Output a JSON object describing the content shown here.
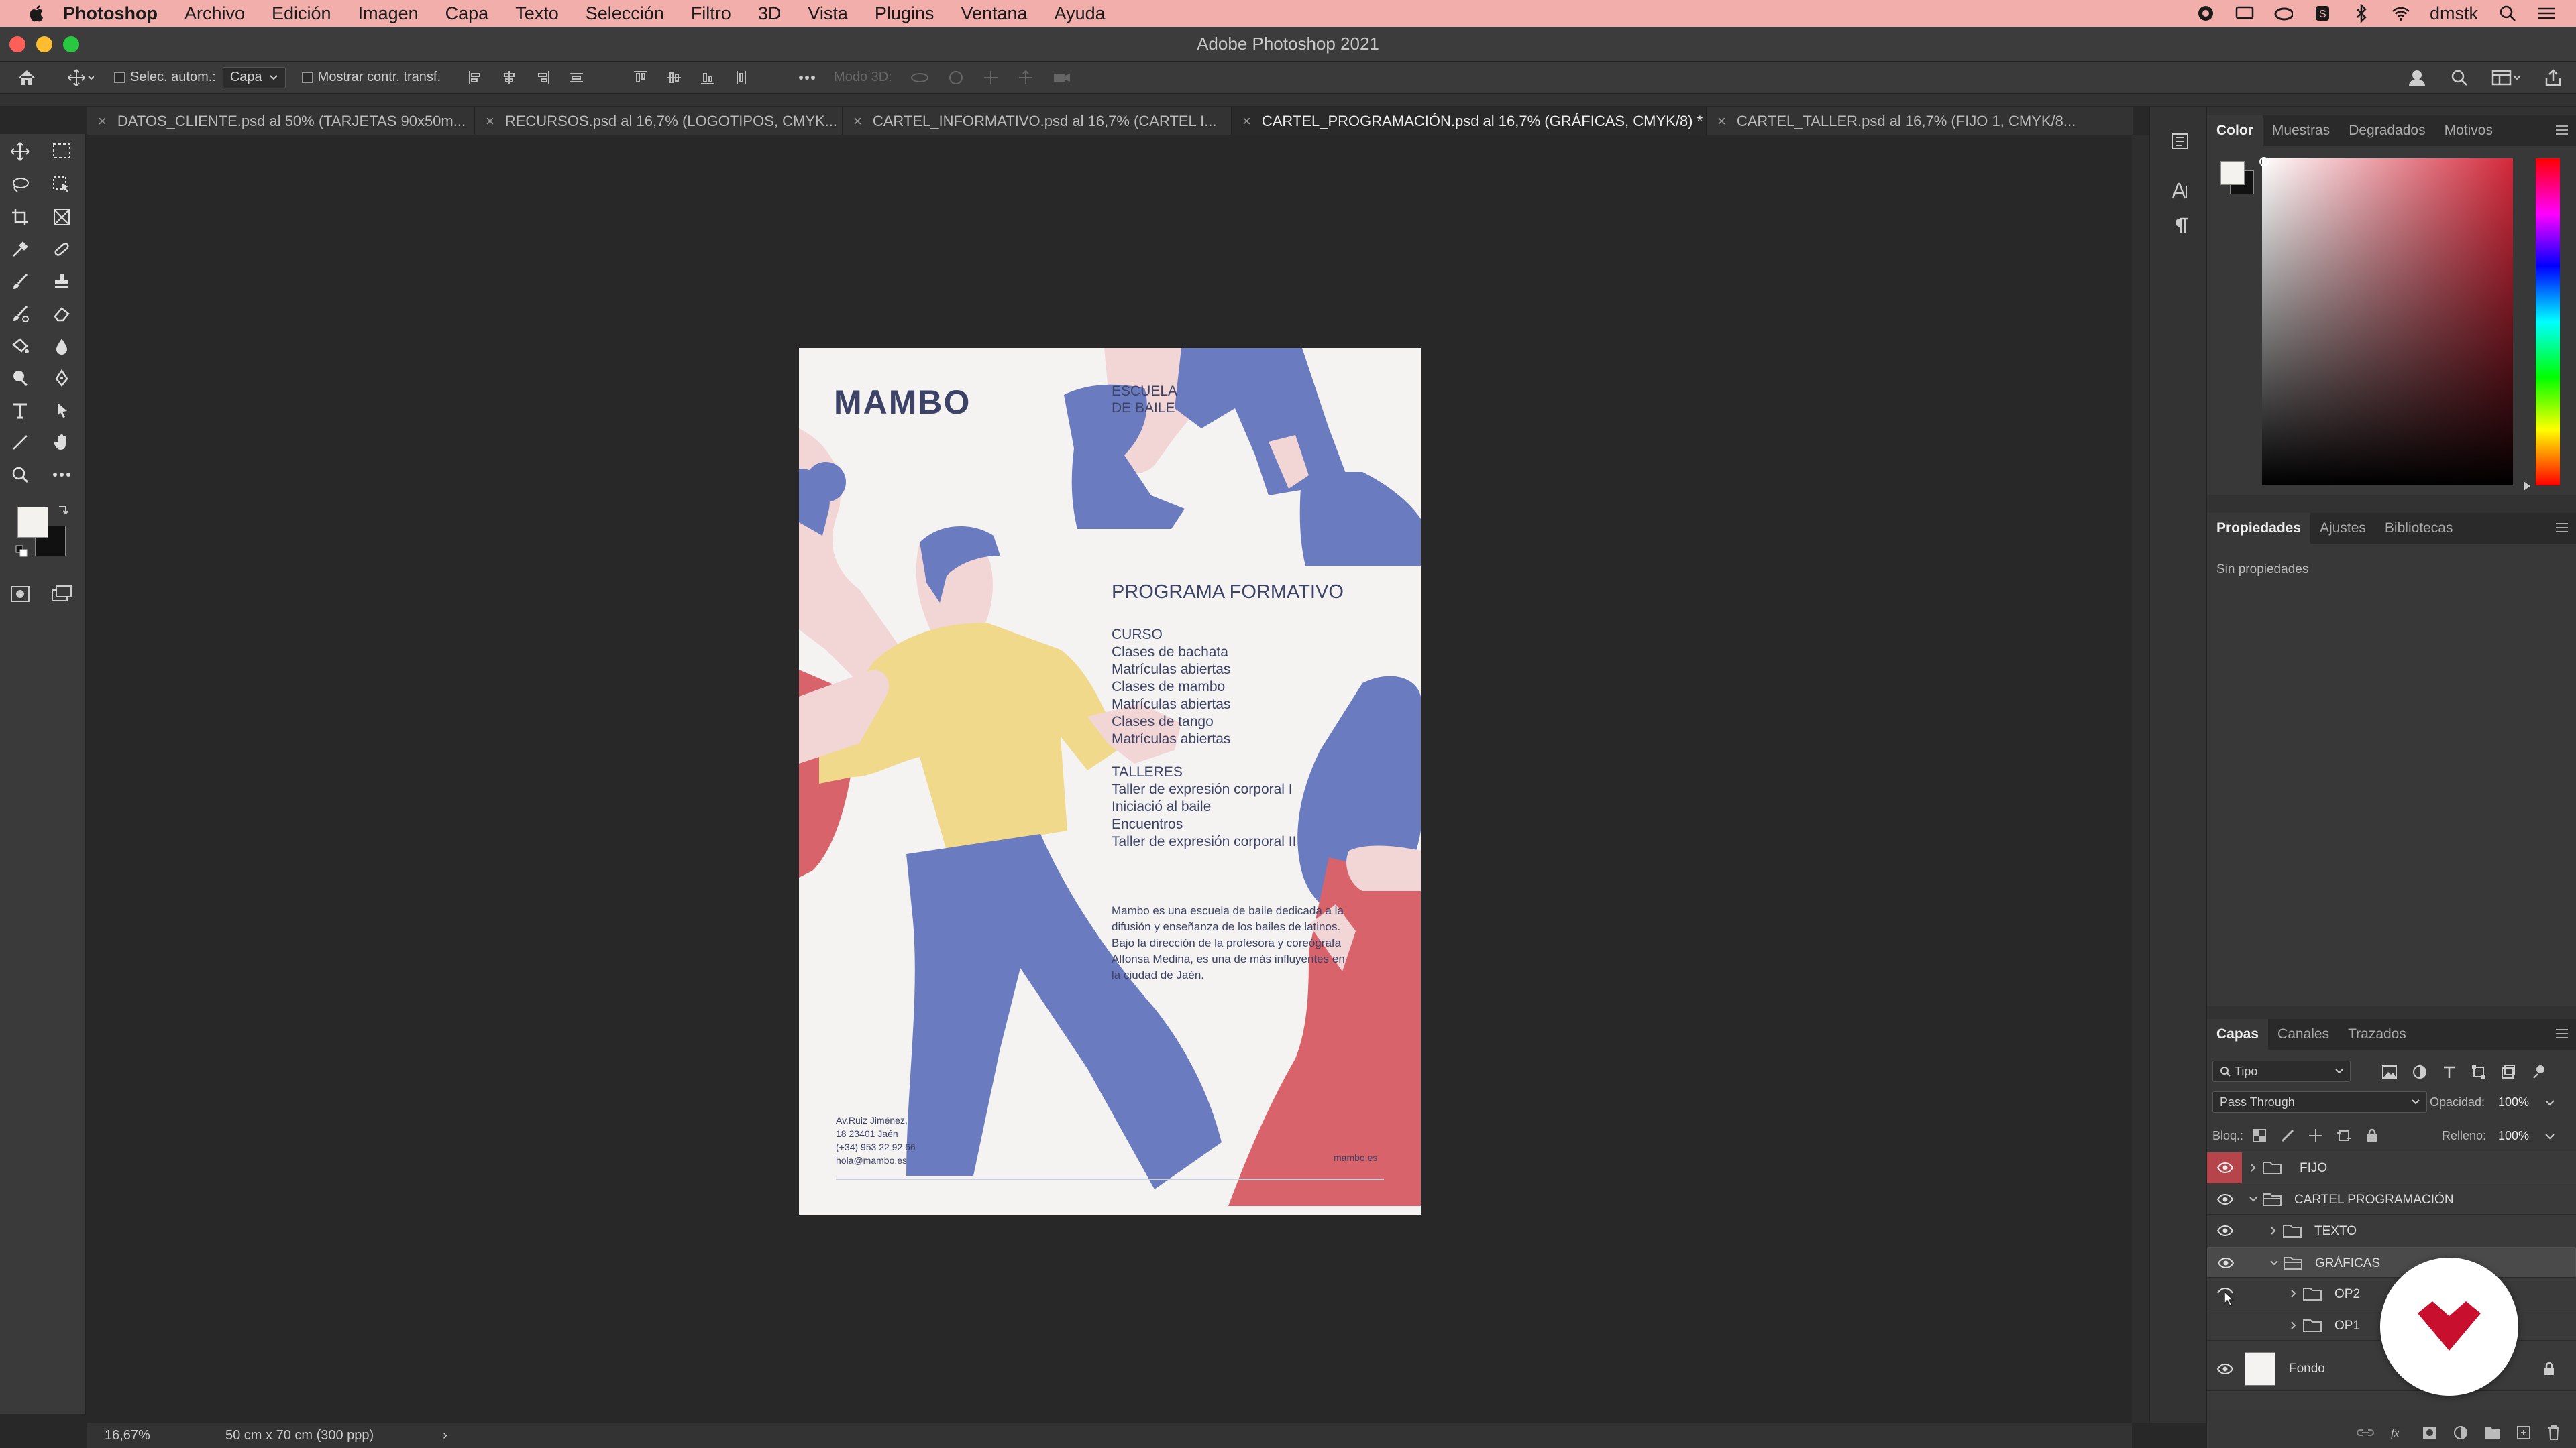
{
  "menubar": {
    "app_name": "Photoshop",
    "items": [
      "Archivo",
      "Edición",
      "Imagen",
      "Capa",
      "Texto",
      "Selección",
      "Filtro",
      "3D",
      "Vista",
      "Plugins",
      "Ventana",
      "Ayuda"
    ],
    "user": "dmstk"
  },
  "window": {
    "title": "Adobe Photoshop 2021"
  },
  "options_bar": {
    "auto_select_label": "Selec. autom.:",
    "auto_select_value": "Capa",
    "transform_controls_label": "Mostrar contr. transf.",
    "mode_3d_label": "Modo 3D:"
  },
  "tabs": [
    {
      "label": "DATOS_CLIENTE.psd al 50% (TARJETAS 90x50m...",
      "active": false
    },
    {
      "label": "RECURSOS.psd al 16,7% (LOGOTIPOS, CMYK...",
      "active": false
    },
    {
      "label": "CARTEL_INFORMATIVO.psd al 16,7% (CARTEL I...",
      "active": false
    },
    {
      "label": "CARTEL_PROGRAMACIÓN.psd al 16,7% (GRÁFICAS, CMYK/8) *",
      "active": true
    },
    {
      "label": "CARTEL_TALLER.psd al 16,7% (FIJO 1, CMYK/8...",
      "active": false
    }
  ],
  "poster": {
    "logo": "MAMBO",
    "tagline_1": "ESCUELA",
    "tagline_2": "DE BAILE",
    "heading": "PROGRAMA FORMATIVO",
    "curso_title": "CURSO",
    "curso_lines": [
      "Clases de bachata",
      "Matrículas abiertas",
      "Clases de mambo",
      "Matrículas abiertas",
      "Clases de tango",
      "Matrículas abiertas"
    ],
    "talleres_title": "TALLERES",
    "talleres_lines": [
      "Taller de expresión corporal I",
      "Iniciació al baile",
      "Encuentros",
      "Taller de expresión corporal II"
    ],
    "description_lines": [
      "Mambo es una escuela de baile dedicada a la",
      "difusión y enseñanza de los bailes de latinos.",
      "Bajo la dirección de la profesora y coreógrafa",
      "Alfonsa Medina, es una de más influyentes en",
      "la ciudad de Jaén."
    ],
    "address_lines": [
      "Av.Ruiz Jiménez,",
      "18 23401 Jaén",
      "(+34) 953 22 92 66",
      "hola@mambo.es"
    ],
    "website": "mambo.es",
    "colors": {
      "blue": "#6b7bbf",
      "pink": "#f2d5d5",
      "yellow": "#f0d98a",
      "red": "#d9636b",
      "text": "#3d4366"
    }
  },
  "status_bar": {
    "zoom": "16,67%",
    "doc_size": "50 cm x 70 cm (300 ppp)"
  },
  "color_panel": {
    "tabs": [
      "Color",
      "Muestras",
      "Degradados",
      "Motivos"
    ],
    "active_tab": "Color",
    "hue_color": "#d4283a"
  },
  "properties_panel": {
    "tabs": [
      "Propiedades",
      "Ajustes",
      "Bibliotecas"
    ],
    "active_tab": "Propiedades",
    "empty_text": "Sin propiedades"
  },
  "layers_panel": {
    "tabs": [
      "Capas",
      "Canales",
      "Trazados"
    ],
    "active_tab": "Capas",
    "filter_kind": "Tipo",
    "blend_mode": "Pass Through",
    "opacity_label": "Opacidad:",
    "opacity_value": "100%",
    "lock_label": "Bloq.:",
    "fill_label": "Relleno:",
    "fill_value": "100%",
    "layers": [
      {
        "name": "FIJO",
        "indent": 0,
        "expanded": false,
        "visible": true,
        "eye_highlight": true
      },
      {
        "name": "CARTEL PROGRAMACIÓN",
        "indent": 0,
        "expanded": true,
        "visible": true,
        "eye_highlight": false
      },
      {
        "name": "TEXTO",
        "indent": 1,
        "expanded": false,
        "visible": true,
        "eye_highlight": false
      },
      {
        "name": "GRÁFICAS",
        "indent": 1,
        "expanded": true,
        "visible": true,
        "eye_highlight": false,
        "selected": true
      },
      {
        "name": "OP2",
        "indent": 2,
        "expanded": false,
        "visible": false,
        "eye_highlight": false
      },
      {
        "name": "OP1",
        "indent": 2,
        "expanded": false,
        "visible": false,
        "eye_highlight": false
      }
    ],
    "background_layer": "Fondo"
  },
  "icons": {
    "apple": "apple-icon",
    "home": "home-icon",
    "move": "move-tool-icon",
    "search": "search-icon",
    "wifi": "wifi-icon",
    "eye": "eye-icon",
    "folder": "folder-icon",
    "lock": "lock-icon"
  }
}
